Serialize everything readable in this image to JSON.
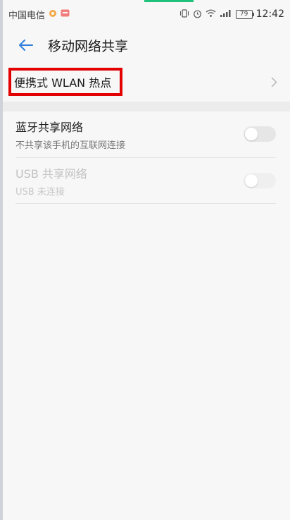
{
  "status_bar": {
    "carrier": "中国电信",
    "battery": "79",
    "time": "12:42",
    "icons": [
      "vibrate-icon",
      "alarm-icon",
      "wifi-icon",
      "signal-icon"
    ]
  },
  "header": {
    "title": "移动网络共享"
  },
  "hotspot": {
    "label": "便携式 WLAN 热点"
  },
  "bluetooth": {
    "title": "蓝牙共享网络",
    "subtitle": "不共享该手机的互联网连接",
    "enabled": false
  },
  "usb": {
    "title": "USB 共享网络",
    "subtitle": "USB 未连接",
    "enabled": false,
    "disabled": true
  },
  "colors": {
    "accent": "#2f7fdc",
    "highlight_box": "#e30000",
    "background": "#f7f7f7"
  }
}
